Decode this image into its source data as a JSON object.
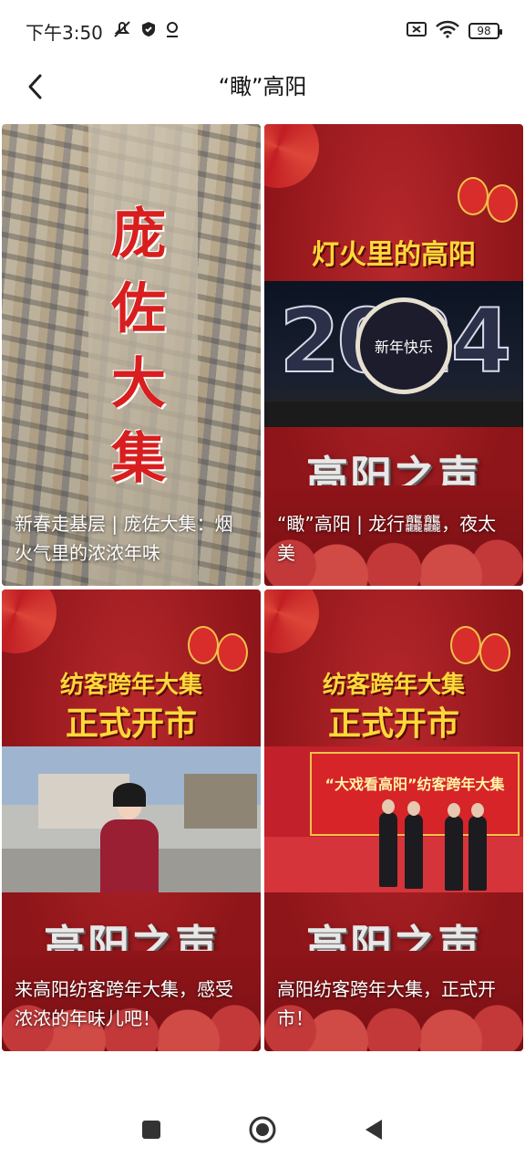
{
  "status_bar": {
    "time": "下午3:50",
    "battery": "98"
  },
  "nav": {
    "title": "“瞰”高阳"
  },
  "cards": [
    {
      "caption": "新春走基层 | 庞佐大集：烟火气里的浓浓年味",
      "image_text": "庞佐大集"
    },
    {
      "caption": "“瞰”高阳 | 龙行龘龘，夜太美",
      "image_text": "灯火里的高阳",
      "year": "2024",
      "emblem": "新年快乐",
      "logo": "高阳之声"
    },
    {
      "caption": "来高阳纺客跨年大集，感受浓浓的年味儿吧！",
      "image_text_line1": "纺客跨年大集",
      "image_text_line2": "正式开市",
      "logo": "高阳之声"
    },
    {
      "caption": "高阳纺客跨年大集，正式开市！",
      "image_text_line1": "纺客跨年大集",
      "image_text_line2": "正式开市",
      "stage_text": "“大戏看高阳”纺客跨年大集",
      "logo": "高阳之声"
    }
  ],
  "icons": {
    "back": "chevron-left-icon",
    "home": "circle-home-icon",
    "recents": "square-recents-icon",
    "nav_back": "triangle-back-icon"
  }
}
